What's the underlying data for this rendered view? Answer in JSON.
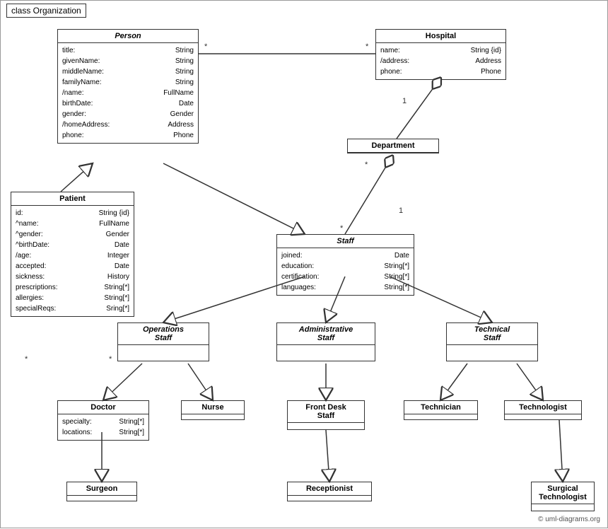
{
  "title": "class Organization",
  "copyright": "© uml-diagrams.org",
  "classes": {
    "person": {
      "name": "Person",
      "italic": true,
      "attrs": [
        {
          "name": "title:",
          "type": "String"
        },
        {
          "name": "givenName:",
          "type": "String"
        },
        {
          "name": "middleName:",
          "type": "String"
        },
        {
          "name": "familyName:",
          "type": "String"
        },
        {
          "name": "/name:",
          "type": "FullName"
        },
        {
          "name": "birthDate:",
          "type": "Date"
        },
        {
          "name": "gender:",
          "type": "Gender"
        },
        {
          "name": "/homeAddress:",
          "type": "Address"
        },
        {
          "name": "phone:",
          "type": "Phone"
        }
      ]
    },
    "hospital": {
      "name": "Hospital",
      "italic": false,
      "attrs": [
        {
          "name": "name:",
          "type": "String {id}"
        },
        {
          "name": "/address:",
          "type": "Address"
        },
        {
          "name": "phone:",
          "type": "Phone"
        }
      ]
    },
    "patient": {
      "name": "Patient",
      "italic": false,
      "attrs": [
        {
          "name": "id:",
          "type": "String {id}"
        },
        {
          "name": "^name:",
          "type": "FullName"
        },
        {
          "name": "^gender:",
          "type": "Gender"
        },
        {
          "name": "^birthDate:",
          "type": "Date"
        },
        {
          "name": "/age:",
          "type": "Integer"
        },
        {
          "name": "accepted:",
          "type": "Date"
        },
        {
          "name": "sickness:",
          "type": "History"
        },
        {
          "name": "prescriptions:",
          "type": "String[*]"
        },
        {
          "name": "allergies:",
          "type": "String[*]"
        },
        {
          "name": "specialReqs:",
          "type": "Sring[*]"
        }
      ]
    },
    "department": {
      "name": "Department",
      "italic": false,
      "attrs": []
    },
    "staff": {
      "name": "Staff",
      "italic": true,
      "attrs": [
        {
          "name": "joined:",
          "type": "Date"
        },
        {
          "name": "education:",
          "type": "String[*]"
        },
        {
          "name": "certification:",
          "type": "String[*]"
        },
        {
          "name": "languages:",
          "type": "String[*]"
        }
      ]
    },
    "operations_staff": {
      "name": "Operations\nStaff",
      "italic": true,
      "attrs": []
    },
    "administrative_staff": {
      "name": "Administrative\nStaff",
      "italic": true,
      "attrs": []
    },
    "technical_staff": {
      "name": "Technical\nStaff",
      "italic": true,
      "attrs": []
    },
    "doctor": {
      "name": "Doctor",
      "italic": false,
      "attrs": [
        {
          "name": "specialty:",
          "type": "String[*]"
        },
        {
          "name": "locations:",
          "type": "String[*]"
        }
      ]
    },
    "nurse": {
      "name": "Nurse",
      "italic": false,
      "attrs": []
    },
    "front_desk_staff": {
      "name": "Front Desk\nStaff",
      "italic": false,
      "attrs": []
    },
    "technician": {
      "name": "Technician",
      "italic": false,
      "attrs": []
    },
    "technologist": {
      "name": "Technologist",
      "italic": false,
      "attrs": []
    },
    "surgeon": {
      "name": "Surgeon",
      "italic": false,
      "attrs": []
    },
    "receptionist": {
      "name": "Receptionist",
      "italic": false,
      "attrs": []
    },
    "surgical_technologist": {
      "name": "Surgical\nTechnologist",
      "italic": false,
      "attrs": []
    }
  }
}
